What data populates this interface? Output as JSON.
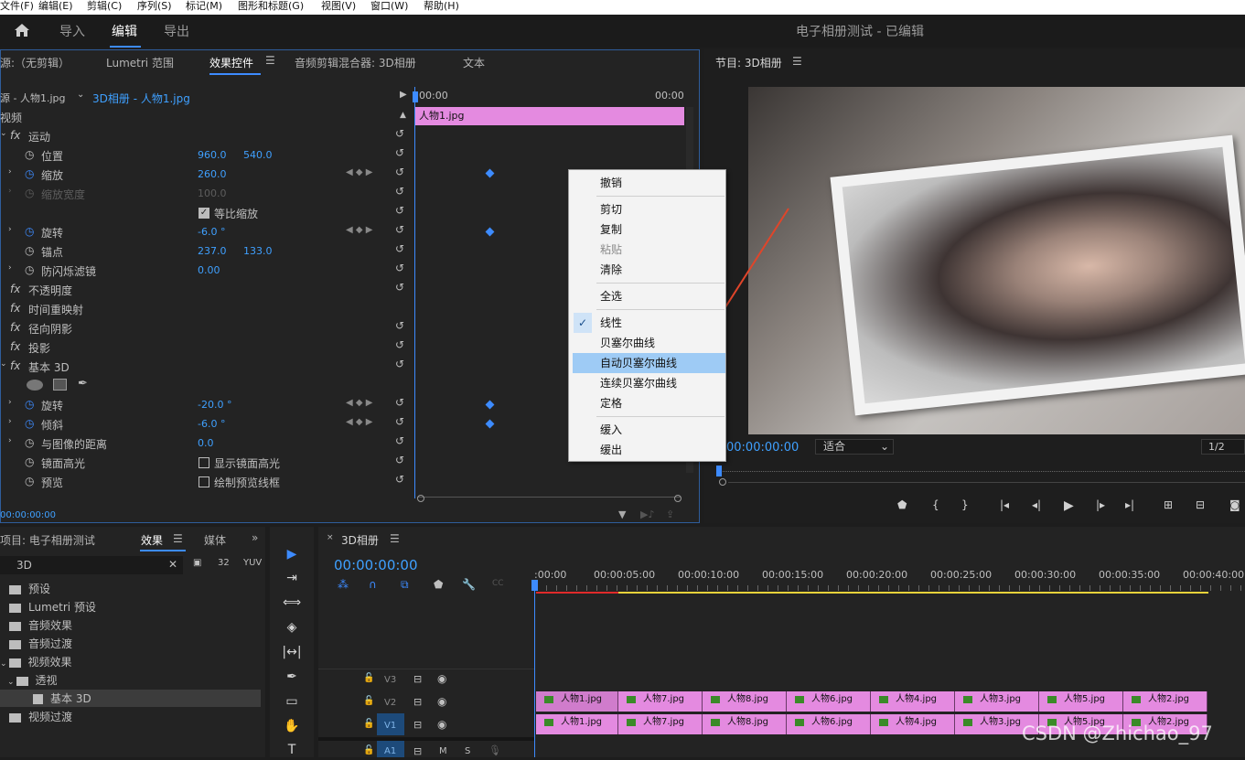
{
  "menubar": [
    "文件(F)",
    "编辑(E)",
    "剪辑(C)",
    "序列(S)",
    "标记(M)",
    "图形和标题(G)",
    "视图(V)",
    "窗口(W)",
    "帮助(H)"
  ],
  "workspaces": {
    "import": "导入",
    "edit": "编辑",
    "export": "导出"
  },
  "project_title": "电子相册测试 - 已编辑",
  "source_tabs": {
    "source": "源:（无剪辑）",
    "lumetri": "Lumetri 范围",
    "effect_controls": "效果控件",
    "audio_mixer": "音频剪辑混合器: 3D相册",
    "text": "文本"
  },
  "ec": {
    "source_label": "源 - 人物1.jpg",
    "sequence_label": "3D相册 - 人物1.jpg",
    "time_start": "00:00",
    "time_end": "00:00",
    "clip_label": "人物1.jpg",
    "video_header": "视频",
    "motion": "运动",
    "position": "位置",
    "pos_x": "960.0",
    "pos_y": "540.0",
    "scale": "缩放",
    "scale_val": "260.0",
    "scale_width": "缩放宽度",
    "scale_width_val": "100.0",
    "uniform": "等比缩放",
    "rotation": "旋转",
    "rotation_val": "-6.0 °",
    "anchor": "锚点",
    "anchor_x": "237.0",
    "anchor_y": "133.0",
    "antiflicker": "防闪烁滤镜",
    "antiflicker_val": "0.00",
    "opacity": "不透明度",
    "time_remap": "时间重映射",
    "radial_shadow": "径向阴影",
    "drop_shadow": "投影",
    "basic3d": "基本 3D",
    "swivel": "旋转",
    "swivel_val": "-20.0 °",
    "tilt": "倾斜",
    "tilt_val": "-6.0 °",
    "distance": "与图像的距离",
    "distance_val": "0.0",
    "specular": "镜面高光",
    "show_specular": "显示镜面高光",
    "preview": "预览",
    "draw_wireframe": "绘制预览线框",
    "timecode": "00:00:00:00"
  },
  "context_menu": {
    "undo": "撤销",
    "cut": "剪切",
    "copy": "复制",
    "paste": "粘贴",
    "clear": "清除",
    "select_all": "全选",
    "linear": "线性",
    "bezier": "贝塞尔曲线",
    "auto_bezier": "自动贝塞尔曲线",
    "continuous_bezier": "连续贝塞尔曲线",
    "hold": "定格",
    "ease_in": "缓入",
    "ease_out": "缓出"
  },
  "program": {
    "title": "节目: 3D相册",
    "timecode": "00:00:00:00",
    "fit": "适合",
    "resolution": "1/2"
  },
  "project": {
    "title": "项目: 电子相册测试",
    "effects_tab": "效果",
    "media_tab": "媒体",
    "search": "3D",
    "items": [
      "预设",
      "Lumetri 预设",
      "音频效果",
      "音频过渡",
      "视频效果",
      "透视",
      "基本 3D",
      "视频过渡"
    ]
  },
  "timeline": {
    "tab": "3D相册",
    "timecode": "00:00:00:00",
    "ruler": [
      ":00:00",
      "00:00:05:00",
      "00:00:10:00",
      "00:00:15:00",
      "00:00:20:00",
      "00:00:25:00",
      "00:00:30:00",
      "00:00:35:00",
      "00:00:40:00"
    ],
    "tracks": {
      "v3": "V3",
      "v2": "V2",
      "v1": "V1",
      "a1": "A1",
      "m": "M",
      "s": "S"
    },
    "clips": [
      "人物1.jpg",
      "人物7.jpg",
      "人物8.jpg",
      "人物6.jpg",
      "人物4.jpg",
      "人物3.jpg",
      "人物5.jpg",
      "人物2.jpg"
    ]
  },
  "watermark": "CSDN @Zhichao_97"
}
